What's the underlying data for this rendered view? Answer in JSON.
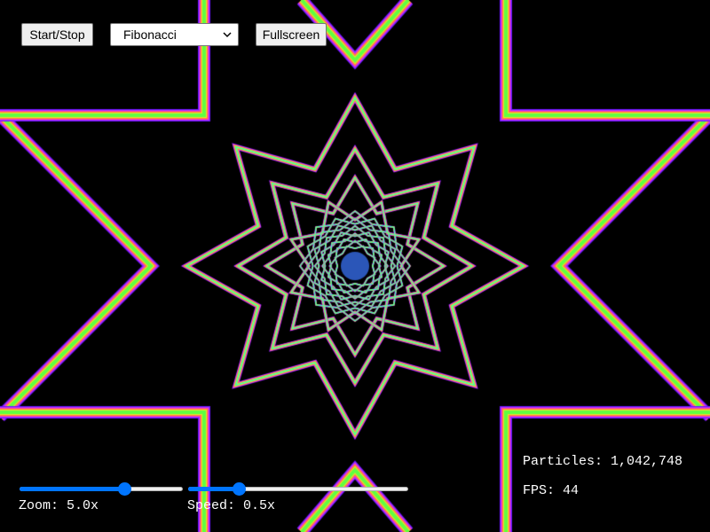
{
  "controls": {
    "start_stop_label": "Start/Stop",
    "pattern_select": {
      "value": "Fibonacci"
    },
    "fullscreen_label": "Fullscreen"
  },
  "sliders": {
    "zoom": {
      "label": "Zoom: 5.0x",
      "value": 5.0,
      "level": 0.64
    },
    "speed": {
      "label": "Speed: 0.5x",
      "value": 0.5,
      "level": 0.23
    }
  },
  "stats": {
    "particles": "Particles: 1,042,748",
    "fps": "FPS: 44"
  },
  "visual": {
    "background": "#000000",
    "accent": "#0075ff",
    "ring_colors": [
      "#7a1cff",
      "#d23cff",
      "#ff3fa8",
      "#ff9a2e",
      "#f1e232",
      "#66ff3c",
      "#3cffd8"
    ],
    "core_color": "#2b56b8"
  }
}
